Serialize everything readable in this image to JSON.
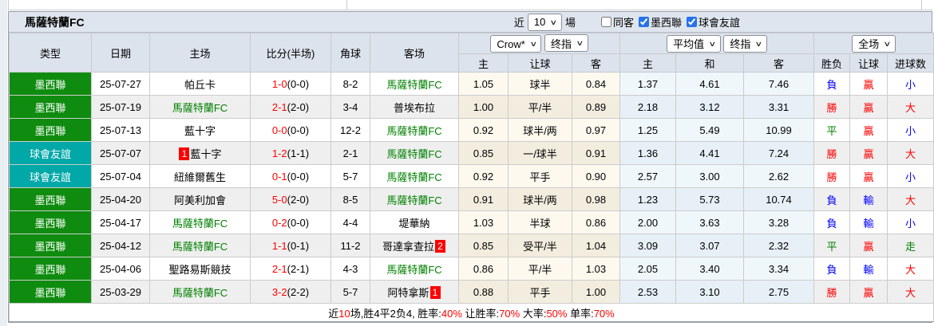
{
  "colors": {
    "badge_league": "#0f8c0f",
    "badge_friendly": "#00a8a8",
    "team_highlight": "#008000",
    "score_red": "#ff0000",
    "result_win_red": "#ff0000",
    "result_lose_blue": "#0000ff",
    "result_draw_green": "#008000",
    "header_bg": "#dde3ec",
    "odds_col_bg": "#fdf9ef",
    "avg_col_bg": "#eff7fb"
  },
  "title_bar": {
    "title": "馬薩特蘭FC",
    "recent_label": "近",
    "recent_count": "10",
    "games_label": "場",
    "filters": [
      {
        "label": "同客",
        "checked": false
      },
      {
        "label": "墨西聯",
        "checked": true
      },
      {
        "label": "球會友誼",
        "checked": true
      }
    ]
  },
  "header": {
    "cols": [
      "类型",
      "日期",
      "主场",
      "比分(半场)",
      "角球",
      "客场"
    ],
    "odds_group": {
      "select1": "Crow*",
      "select2": "终指",
      "sub": [
        "主",
        "让球",
        "客"
      ]
    },
    "avg_group": {
      "select1": "平均值",
      "select2": "终指",
      "sub": [
        "主",
        "和",
        "客"
      ]
    },
    "result_group": {
      "select1": "全场",
      "sub": [
        "胜负",
        "让球",
        "进球数"
      ]
    }
  },
  "rows": [
    {
      "type": "墨西聯",
      "style": "league",
      "date": "25-07-27",
      "home": {
        "name": "帕丘卡",
        "color": "black"
      },
      "ft": "1-0",
      "ht": "(0-0)",
      "corners": "8-2",
      "away": {
        "name": "馬薩特蘭FC",
        "color": "green"
      },
      "odds": [
        "1.05",
        "球半",
        "0.84"
      ],
      "avg": [
        "1.37",
        "4.61",
        "7.46"
      ],
      "res": [
        {
          "t": "負",
          "c": "blue"
        },
        {
          "t": "贏",
          "c": "red"
        },
        {
          "t": "小",
          "c": "blue"
        }
      ]
    },
    {
      "type": "墨西聯",
      "style": "league",
      "date": "25-07-19",
      "home": {
        "name": "馬薩特蘭FC",
        "color": "green"
      },
      "ft": "2-1",
      "ht": "(2-0)",
      "corners": "3-4",
      "away": {
        "name": "普埃布拉",
        "color": "black"
      },
      "odds": [
        "1.00",
        "平/半",
        "0.89"
      ],
      "avg": [
        "2.18",
        "3.12",
        "3.31"
      ],
      "res": [
        {
          "t": "勝",
          "c": "red"
        },
        {
          "t": "贏",
          "c": "red"
        },
        {
          "t": "大",
          "c": "red"
        }
      ]
    },
    {
      "type": "墨西聯",
      "style": "league",
      "date": "25-07-13",
      "home": {
        "name": "藍十字",
        "color": "black"
      },
      "ft": "0-0",
      "ht": "(0-0)",
      "corners": "12-2",
      "away": {
        "name": "馬薩特蘭FC",
        "color": "green"
      },
      "odds": [
        "0.92",
        "球半/两",
        "0.97"
      ],
      "avg": [
        "1.25",
        "5.49",
        "10.99"
      ],
      "res": [
        {
          "t": "平",
          "c": "green"
        },
        {
          "t": "贏",
          "c": "red"
        },
        {
          "t": "小",
          "c": "blue"
        }
      ]
    },
    {
      "type": "球會友誼",
      "style": "friendly",
      "date": "25-07-07",
      "home": {
        "name": "藍十字",
        "color": "black",
        "card": "1",
        "card_pos": "before"
      },
      "ft": "1-2",
      "ht": "(1-1)",
      "corners": "2-1",
      "away": {
        "name": "馬薩特蘭FC",
        "color": "green"
      },
      "odds": [
        "0.85",
        "一/球半",
        "0.91"
      ],
      "avg": [
        "1.36",
        "4.41",
        "7.24"
      ],
      "res": [
        {
          "t": "勝",
          "c": "red"
        },
        {
          "t": "贏",
          "c": "red"
        },
        {
          "t": "大",
          "c": "red"
        }
      ]
    },
    {
      "type": "球會友誼",
      "style": "friendly",
      "date": "25-07-04",
      "home": {
        "name": "紐維爾舊生",
        "color": "black"
      },
      "ft": "0-1",
      "ht": "(0-0)",
      "corners": "5-7",
      "away": {
        "name": "馬薩特蘭FC",
        "color": "green"
      },
      "odds": [
        "0.92",
        "平手",
        "0.90"
      ],
      "avg": [
        "2.57",
        "3.00",
        "2.62"
      ],
      "res": [
        {
          "t": "勝",
          "c": "red"
        },
        {
          "t": "贏",
          "c": "red"
        },
        {
          "t": "小",
          "c": "blue"
        }
      ]
    },
    {
      "type": "墨西聯",
      "style": "league",
      "date": "25-04-20",
      "home": {
        "name": "阿美利加會",
        "color": "black"
      },
      "ft": "5-0",
      "ht": "(2-0)",
      "corners": "8-5",
      "away": {
        "name": "馬薩特蘭FC",
        "color": "green"
      },
      "odds": [
        "0.91",
        "球半/两",
        "0.98"
      ],
      "avg": [
        "1.23",
        "5.73",
        "10.74"
      ],
      "res": [
        {
          "t": "負",
          "c": "blue"
        },
        {
          "t": "輸",
          "c": "blue"
        },
        {
          "t": "大",
          "c": "red"
        }
      ]
    },
    {
      "type": "墨西聯",
      "style": "league",
      "date": "25-04-17",
      "home": {
        "name": "馬薩特蘭FC",
        "color": "green"
      },
      "ft": "0-2",
      "ht": "(0-0)",
      "corners": "4-4",
      "away": {
        "name": "堤華納",
        "color": "black"
      },
      "odds": [
        "1.03",
        "半球",
        "0.86"
      ],
      "avg": [
        "2.00",
        "3.63",
        "3.28"
      ],
      "res": [
        {
          "t": "負",
          "c": "blue"
        },
        {
          "t": "輸",
          "c": "blue"
        },
        {
          "t": "小",
          "c": "blue"
        }
      ]
    },
    {
      "type": "墨西聯",
      "style": "league",
      "date": "25-04-12",
      "home": {
        "name": "馬薩特蘭FC",
        "color": "green"
      },
      "ft": "1-1",
      "ht": "(0-1)",
      "corners": "11-2",
      "away": {
        "name": "哥達拿查拉",
        "color": "black",
        "card": "2",
        "card_pos": "after"
      },
      "odds": [
        "0.85",
        "受平/半",
        "1.04"
      ],
      "avg": [
        "3.09",
        "3.07",
        "2.32"
      ],
      "res": [
        {
          "t": "平",
          "c": "green"
        },
        {
          "t": "贏",
          "c": "red"
        },
        {
          "t": "走",
          "c": "green"
        }
      ]
    },
    {
      "type": "墨西聯",
      "style": "league",
      "date": "25-04-06",
      "home": {
        "name": "聖路易斯競技",
        "color": "black"
      },
      "ft": "2-1",
      "ht": "(2-1)",
      "corners": "4-3",
      "away": {
        "name": "馬薩特蘭FC",
        "color": "green"
      },
      "odds": [
        "0.86",
        "平/半",
        "1.03"
      ],
      "avg": [
        "2.05",
        "3.40",
        "3.34"
      ],
      "res": [
        {
          "t": "負",
          "c": "blue"
        },
        {
          "t": "輸",
          "c": "blue"
        },
        {
          "t": "大",
          "c": "red"
        }
      ]
    },
    {
      "type": "墨西聯",
      "style": "league",
      "date": "25-03-29",
      "home": {
        "name": "馬薩特蘭FC",
        "color": "green"
      },
      "ft": "3-2",
      "ht": "(2-2)",
      "corners": "5-7",
      "away": {
        "name": "阿特拿斯",
        "color": "black",
        "card": "1",
        "card_pos": "after"
      },
      "odds": [
        "0.88",
        "平手",
        "1.00"
      ],
      "avg": [
        "2.53",
        "3.10",
        "2.75"
      ],
      "res": [
        {
          "t": "勝",
          "c": "red"
        },
        {
          "t": "贏",
          "c": "red"
        },
        {
          "t": "大",
          "c": "red"
        }
      ]
    }
  ],
  "footer": {
    "segments": [
      {
        "text": "近",
        "color": "black"
      },
      {
        "text": "10",
        "color": "red"
      },
      {
        "text": "场,胜4平2负4, 胜率:",
        "color": "black"
      },
      {
        "text": "40%",
        "color": "red"
      },
      {
        "text": " 让胜率:",
        "color": "black"
      },
      {
        "text": "70%",
        "color": "red"
      },
      {
        "text": " 大率:",
        "color": "black"
      },
      {
        "text": "50%",
        "color": "red"
      },
      {
        "text": " 单率:",
        "color": "black"
      },
      {
        "text": "70%",
        "color": "red"
      }
    ]
  }
}
